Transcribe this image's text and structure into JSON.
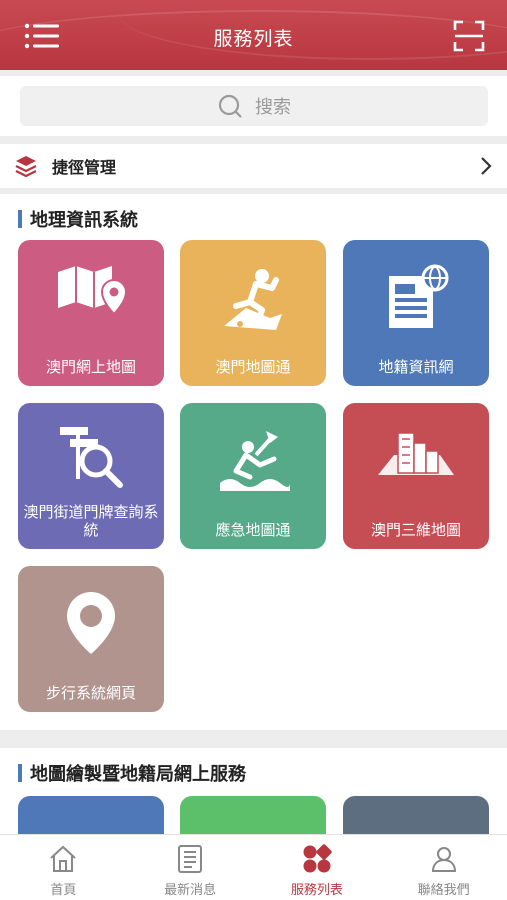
{
  "header": {
    "title": "服務列表"
  },
  "search": {
    "placeholder": "搜索"
  },
  "shortcut": {
    "label": "捷徑管理"
  },
  "sections": [
    {
      "title": "地理資訊系統",
      "tiles": [
        {
          "label": "澳門網上地圖",
          "color": "#cc5c82",
          "icon": "map-pin-icon"
        },
        {
          "label": "澳門地圖通",
          "color": "#e8b35a",
          "icon": "runner-icon"
        },
        {
          "label": "地籍資訊網",
          "color": "#4f78b8",
          "icon": "document-globe-icon"
        },
        {
          "label": "澳門街道門牌查詢系統",
          "color": "#6c6bb3",
          "icon": "street-search-icon"
        },
        {
          "label": "應急地圖通",
          "color": "#56aa8a",
          "icon": "emergency-icon"
        },
        {
          "label": "澳門三維地圖",
          "color": "#c54e55",
          "icon": "city-3d-icon"
        },
        {
          "label": "步行系統網頁",
          "color": "#b2948f",
          "icon": "location-pin-icon"
        }
      ]
    },
    {
      "title": "地圖繪製暨地籍局網上服務",
      "tiles": [
        {
          "color": "#4f78b8"
        },
        {
          "color": "#5cbf6a"
        },
        {
          "color": "#5c6e80"
        }
      ]
    }
  ],
  "nav": [
    {
      "label": "首頁",
      "icon": "home-icon",
      "active": false
    },
    {
      "label": "最新消息",
      "icon": "news-icon",
      "active": false
    },
    {
      "label": "服務列表",
      "icon": "services-icon",
      "active": true
    },
    {
      "label": "聯絡我們",
      "icon": "contact-icon",
      "active": false
    }
  ],
  "colors": {
    "header": "#b8363f",
    "accent": "#b8363f",
    "section_bar": "#4a7ab9"
  }
}
